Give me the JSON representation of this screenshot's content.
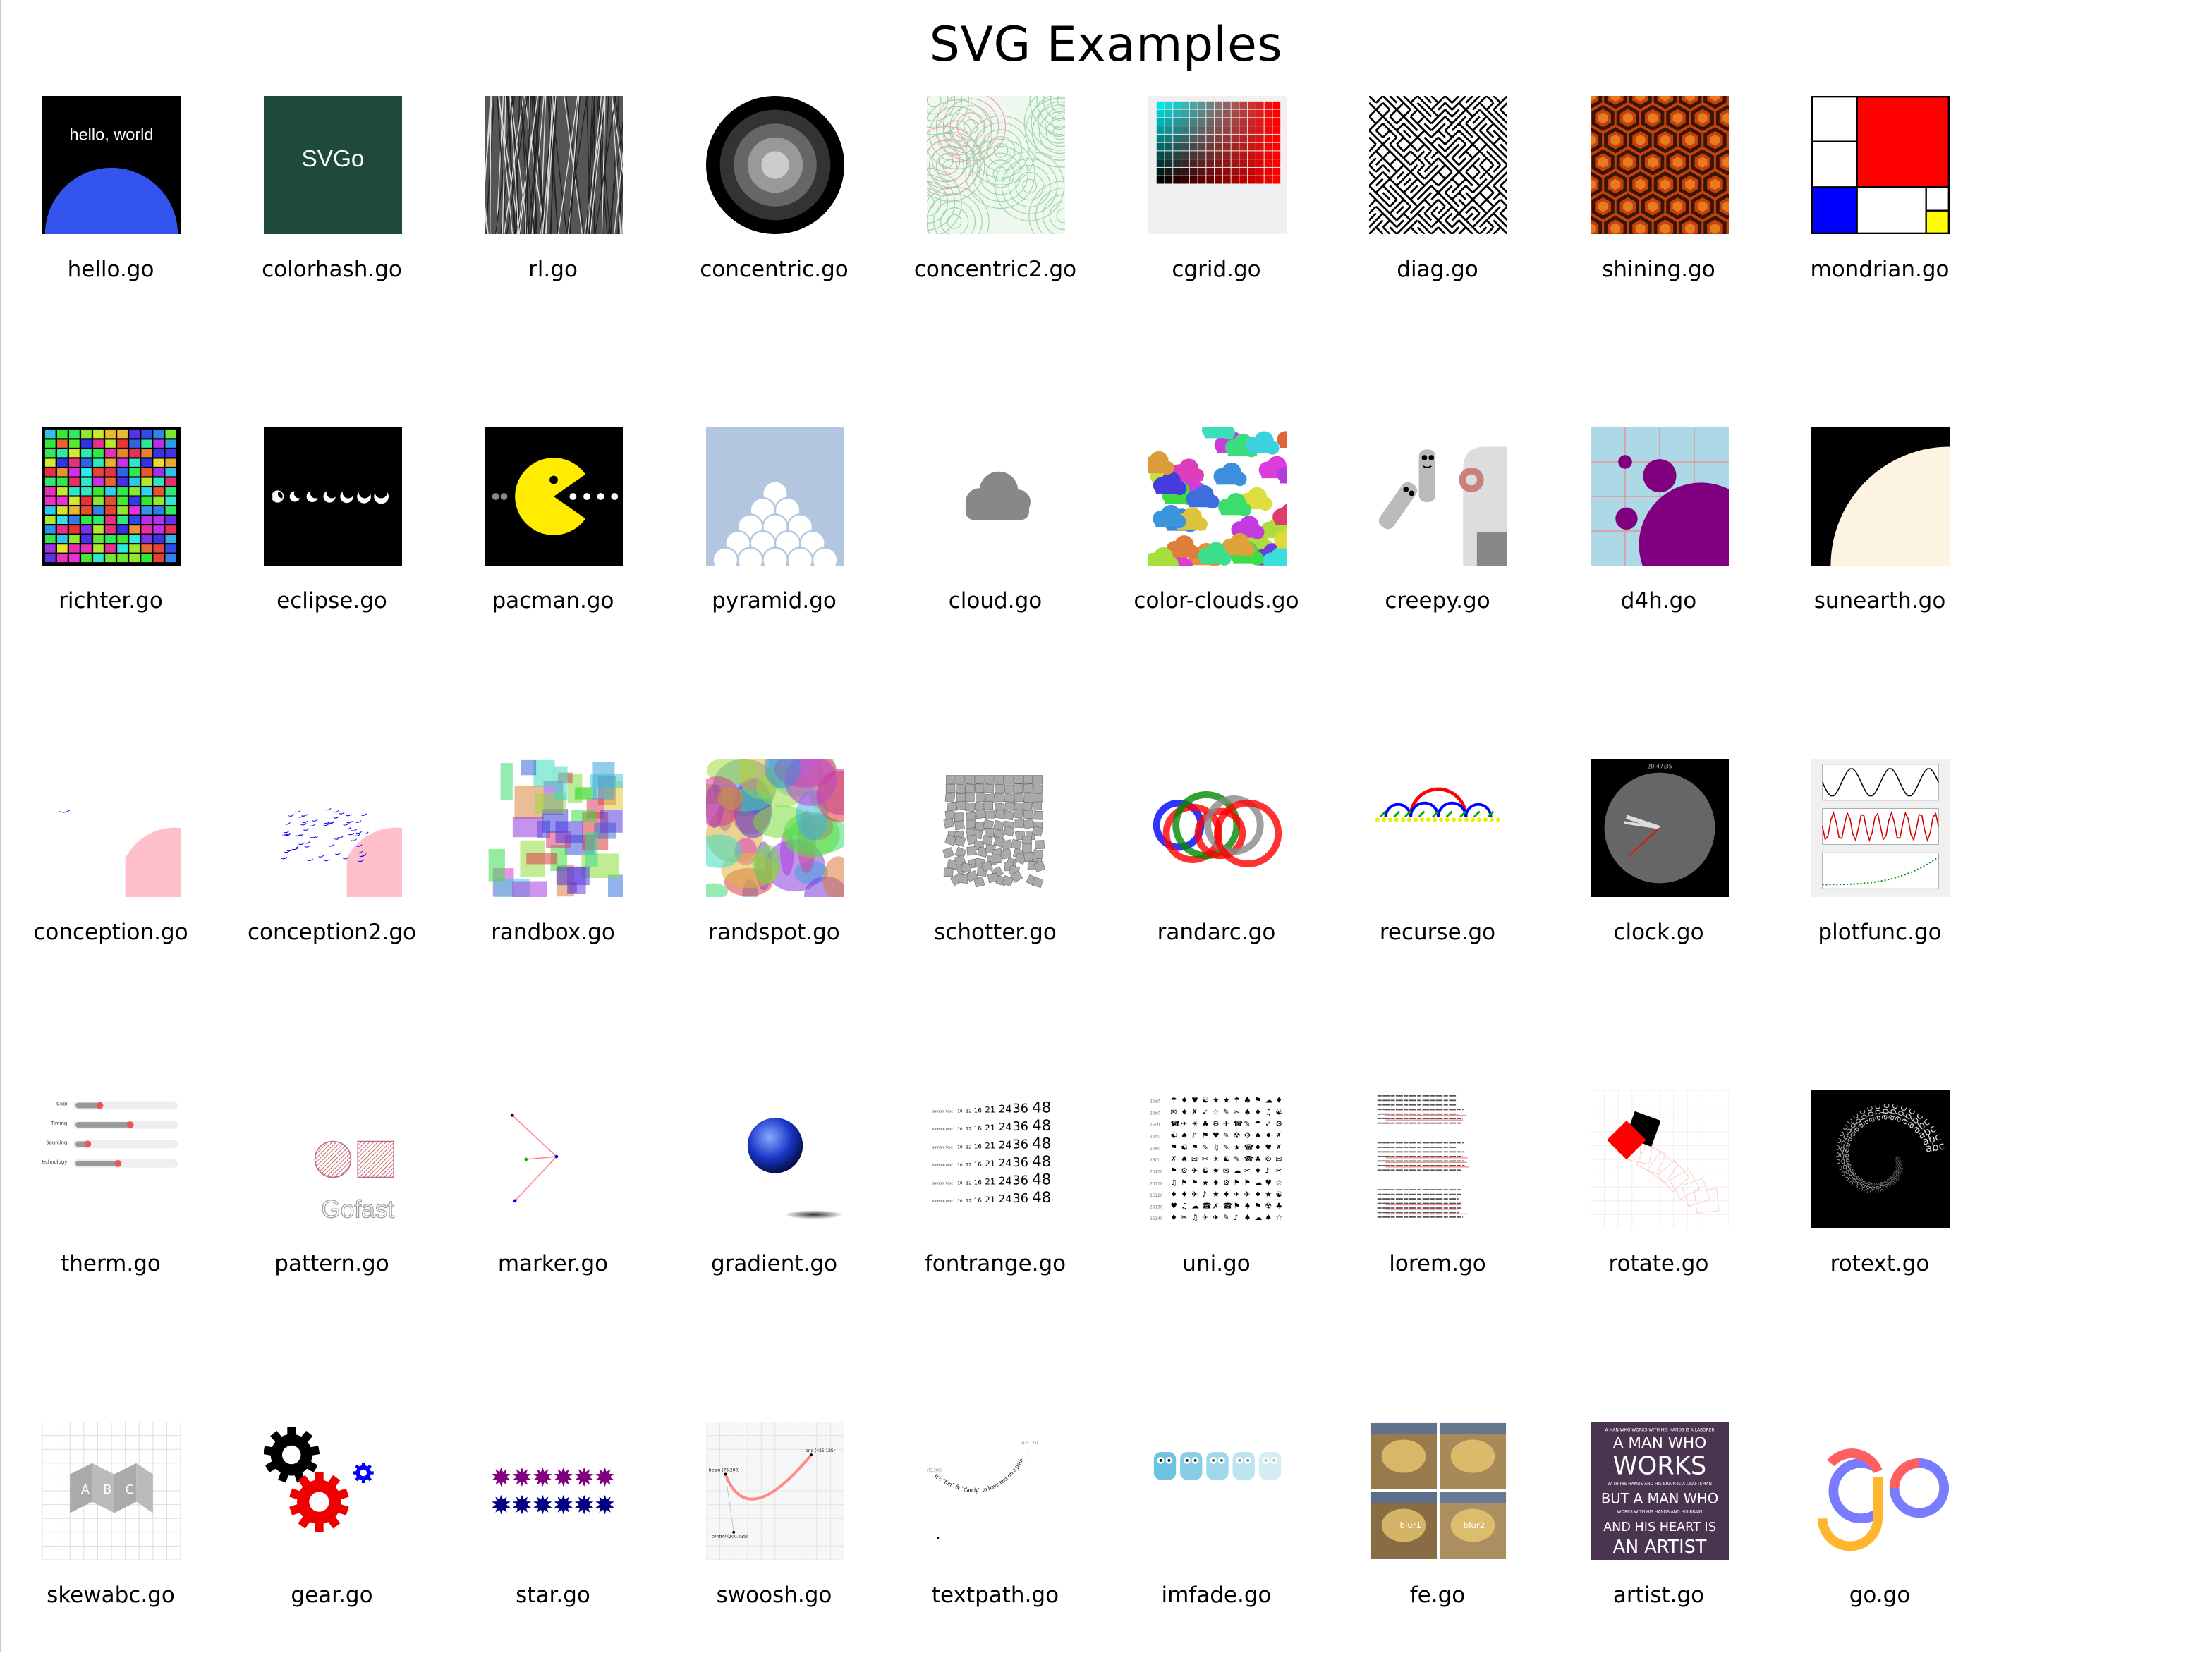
{
  "title": "SVG Examples",
  "examples": [
    {
      "label": "hello.go",
      "icon": "hello-world-thumbnail",
      "overlay_text": "hello, world"
    },
    {
      "label": "colorhash.go",
      "icon": "colorhash-thumbnail",
      "overlay_text": "SVGo"
    },
    {
      "label": "rl.go",
      "icon": "random-lines-thumbnail"
    },
    {
      "label": "concentric.go",
      "icon": "concentric-circles-thumbnail"
    },
    {
      "label": "concentric2.go",
      "icon": "concentric-pastel-circles-thumbnail"
    },
    {
      "label": "cgrid.go",
      "icon": "color-grid-thumbnail"
    },
    {
      "label": "diag.go",
      "icon": "diagonal-lines-thumbnail"
    },
    {
      "label": "shining.go",
      "icon": "shining-carpet-thumbnail"
    },
    {
      "label": "mondrian.go",
      "icon": "mondrian-thumbnail"
    },
    {
      "label": "richter.go",
      "icon": "richter-grid-thumbnail"
    },
    {
      "label": "eclipse.go",
      "icon": "eclipse-phases-thumbnail"
    },
    {
      "label": "pacman.go",
      "icon": "pacman-thumbnail"
    },
    {
      "label": "pyramid.go",
      "icon": "pyramid-thumbnail"
    },
    {
      "label": "cloud.go",
      "icon": "cloud-thumbnail"
    },
    {
      "label": "color-clouds.go",
      "icon": "color-clouds-thumbnail"
    },
    {
      "label": "creepy.go",
      "icon": "creepy-thumbnail"
    },
    {
      "label": "d4h.go",
      "icon": "d4h-thumbnail"
    },
    {
      "label": "sunearth.go",
      "icon": "sun-earth-thumbnail"
    },
    {
      "label": "conception.go",
      "icon": "conception-thumbnail"
    },
    {
      "label": "conception2.go",
      "icon": "conception2-thumbnail"
    },
    {
      "label": "randbox.go",
      "icon": "random-boxes-thumbnail"
    },
    {
      "label": "randspot.go",
      "icon": "random-spots-thumbnail"
    },
    {
      "label": "schotter.go",
      "icon": "schotter-thumbnail"
    },
    {
      "label": "randarc.go",
      "icon": "random-arcs-thumbnail"
    },
    {
      "label": "recurse.go",
      "icon": "recursive-arcs-thumbnail"
    },
    {
      "label": "clock.go",
      "icon": "clock-thumbnail"
    },
    {
      "label": "plotfunc.go",
      "icon": "plot-functions-thumbnail"
    },
    {
      "label": "therm.go",
      "icon": "thermometer-bars-thumbnail"
    },
    {
      "label": "pattern.go",
      "icon": "pattern-thumbnail",
      "overlay_text": "Gofast"
    },
    {
      "label": "marker.go",
      "icon": "marker-thumbnail"
    },
    {
      "label": "gradient.go",
      "icon": "gradient-sphere-thumbnail"
    },
    {
      "label": "fontrange.go",
      "icon": "font-range-thumbnail"
    },
    {
      "label": "uni.go",
      "icon": "unicode-grid-thumbnail"
    },
    {
      "label": "lorem.go",
      "icon": "lorem-text-thumbnail"
    },
    {
      "label": "rotate.go",
      "icon": "rotate-squares-thumbnail"
    },
    {
      "label": "rotext.go",
      "icon": "rotated-text-thumbnail"
    },
    {
      "label": "skewabc.go",
      "icon": "skew-abc-thumbnail"
    },
    {
      "label": "gear.go",
      "icon": "gears-thumbnail"
    },
    {
      "label": "star.go",
      "icon": "stars-thumbnail"
    },
    {
      "label": "swoosh.go",
      "icon": "swoosh-curve-thumbnail"
    },
    {
      "label": "textpath.go",
      "icon": "text-path-thumbnail"
    },
    {
      "label": "imfade.go",
      "icon": "image-fade-thumbnail"
    },
    {
      "label": "fe.go",
      "icon": "filter-effects-thumbnail",
      "overlay_text": [
        "blur1",
        "blur2"
      ]
    },
    {
      "label": "artist.go",
      "icon": "artist-poster-thumbnail",
      "overlay_text": [
        "A MAN WHO WORKS WITH HIS HANDS IS A LABORER",
        "A MAN WHO",
        "WORKS",
        "WITH HIS HANDS AND HIS BRAIN IS A CRAFTSMAN",
        "BUT A MAN WHO",
        "WORKS WITH HIS HANDS AND HIS BRAIN",
        "AND HIS HEART IS",
        "AN ARTIST"
      ]
    },
    {
      "label": "go.go",
      "icon": "go-logo-thumbnail"
    }
  ]
}
